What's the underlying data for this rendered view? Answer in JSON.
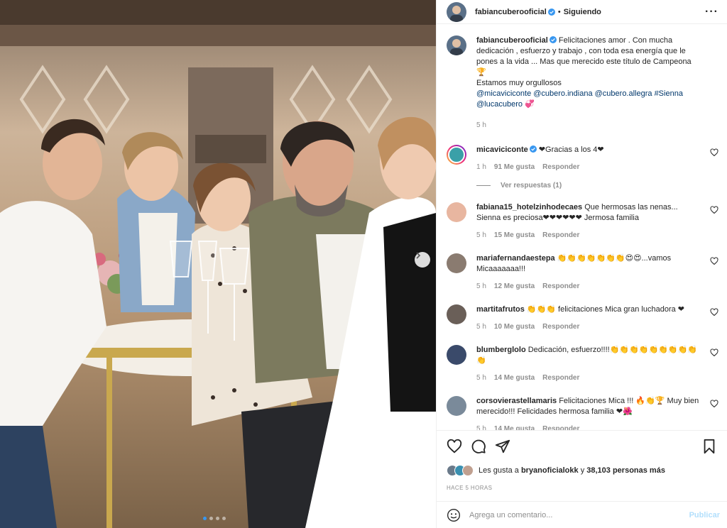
{
  "post": {
    "username": "fabiancuberooficial",
    "separator": "•",
    "follow_status": "Siguiendo",
    "more_icon": "more-horizontal-icon"
  },
  "caption": {
    "username": "fabiancuberooficial",
    "line1": "Felicitaciones amor . Con mucha dedicación , esfuerzo y trabajo , con toda esa energía que le pones a la vida ... Mas que merecido este título de Campeona 🏆",
    "line2": "Estamos muy orgullosos",
    "mentions": "@micaviciconte @cubero.indiana @cubero.allegra #Sienna @lucacubero 💞",
    "time": "5 h"
  },
  "comments": [
    {
      "username": "micaviciconte",
      "verified": true,
      "text": "❤Gracias a los 4❤",
      "time": "1 h",
      "likes": "91 Me gusta",
      "reply": "Responder",
      "replies": "Ver respuestas (1)"
    },
    {
      "username": "fabiana15_hotelzinhodecaes",
      "text": "Que hermosas las nenas... Sienna es preciosa❤❤❤❤❤❤ Jermosa familia",
      "time": "5 h",
      "likes": "15 Me gusta",
      "reply": "Responder"
    },
    {
      "username": "mariafernandaestepa",
      "text": "👏👏👏👏👏👏👏😍😍...vamos Micaaaaaaa!!!",
      "time": "5 h",
      "likes": "12 Me gusta",
      "reply": "Responder"
    },
    {
      "username": "martitafrutos",
      "text": "👏👏👏 felicitaciones Mica gran luchadora ❤",
      "time": "5 h",
      "likes": "10 Me gusta",
      "reply": "Responder"
    },
    {
      "username": "blumberglolo",
      "text": "Dedicación, esfuerzo!!!!👏👏👏👏👏👏👏👏👏👏",
      "time": "5 h",
      "likes": "14 Me gusta",
      "reply": "Responder"
    },
    {
      "username": "corsovierastellamaris",
      "text": "Felicitaciones Mica !!! 🔥👏🏆 Muy bien merecido!!! Felicidades hermosa familia ❤🌺",
      "time": "5 h",
      "likes": "14 Me gusta",
      "reply": "Responder"
    }
  ],
  "likes": {
    "prefix": "Les gusta a",
    "user": "bryanoficialokk",
    "middle": "y",
    "count": "38,103 personas más"
  },
  "timestamp": "HACE 5 HORAS",
  "add_comment": {
    "placeholder": "Agrega un comentario...",
    "publish": "Publicar"
  },
  "colors": {
    "link": "#00376b",
    "verified": "#3897f0",
    "heart": "#ed4956",
    "publish_disabled": "#b2dffc",
    "muted": "#8e8e8e"
  }
}
